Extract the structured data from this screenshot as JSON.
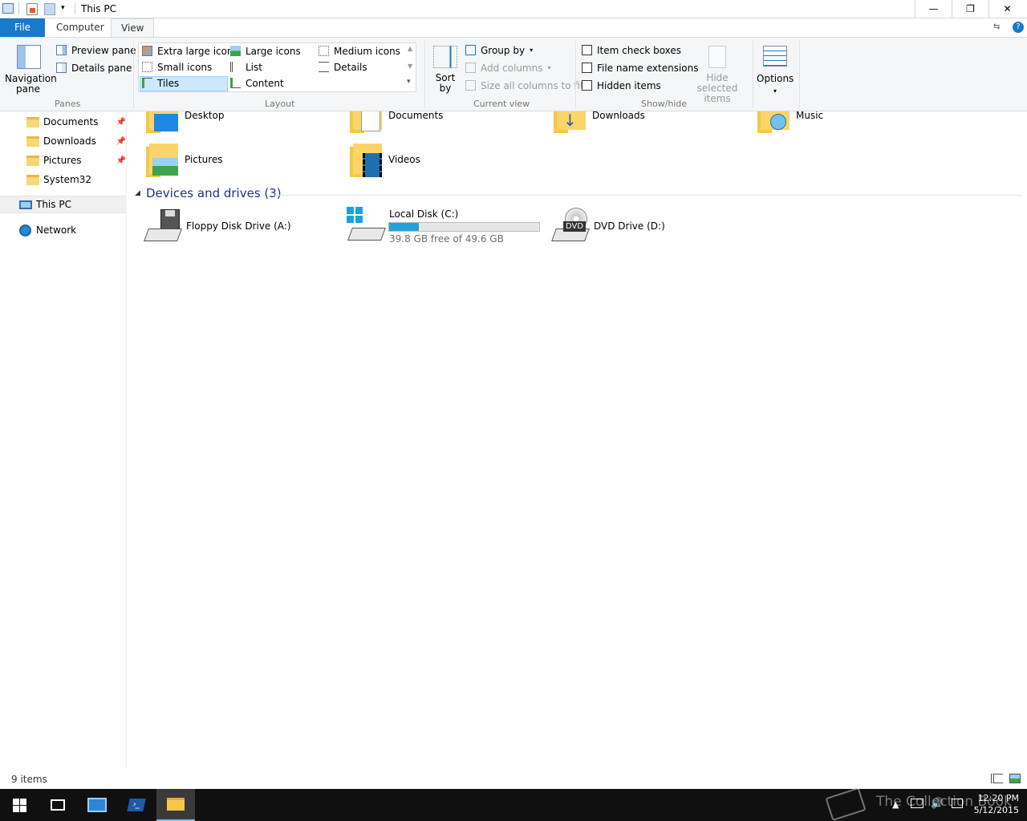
{
  "window": {
    "title": "This PC",
    "minimize_glyph": "—",
    "restore_glyph": "❐",
    "close_glyph": "✕"
  },
  "tabs": [
    {
      "label": "File"
    },
    {
      "label": "Computer"
    },
    {
      "label": "View"
    }
  ],
  "ribbon": {
    "panes": {
      "navigation_pane": "Navigation pane",
      "preview_pane": "Preview pane",
      "details_pane": "Details pane",
      "group_label": "Panes"
    },
    "layout": {
      "items": [
        "Extra large icons",
        "Large icons",
        "Medium icons",
        "Small icons",
        "List",
        "Details",
        "Tiles",
        "Content"
      ],
      "selected": "Tiles",
      "group_label": "Layout"
    },
    "current_view": {
      "sort_by": "Sort by",
      "group_by": "Group by",
      "add_columns": "Add columns",
      "size_all_columns": "Size all columns to fit",
      "group_label": "Current view"
    },
    "show_hide": {
      "item_check_boxes": "Item check boxes",
      "file_name_extensions": "File name extensions",
      "hidden_items": "Hidden items",
      "hide_selected_items": "Hide selected items",
      "group_label": "Show/hide"
    },
    "options": "Options"
  },
  "nav": {
    "items": [
      {
        "label": "Documents",
        "pinned": true
      },
      {
        "label": "Downloads",
        "pinned": true
      },
      {
        "label": "Pictures",
        "pinned": true
      },
      {
        "label": "System32",
        "pinned": false
      }
    ],
    "this_pc": "This PC",
    "network": "Network"
  },
  "folders": [
    {
      "label": "Desktop"
    },
    {
      "label": "Documents"
    },
    {
      "label": "Downloads"
    },
    {
      "label": "Music"
    },
    {
      "label": "Pictures"
    },
    {
      "label": "Videos"
    }
  ],
  "devices": {
    "header": "Devices and drives (3)",
    "items": [
      {
        "label": "Floppy Disk Drive (A:)"
      },
      {
        "label": "Local Disk (C:)",
        "free_text": "39.8 GB free of 49.6 GB",
        "used_fraction": 0.2
      },
      {
        "label": "DVD Drive (D:)",
        "badge": "DVD"
      }
    ]
  },
  "status": {
    "items_count": "9 items"
  },
  "taskbar": {
    "time": "12:20 PM",
    "date": "5/12/2015",
    "watermark": "The Collection Book"
  },
  "colors": {
    "accent": "#1979ca",
    "selection": "#cce8ff",
    "drive_fill": "#26a0da",
    "taskbar": "#101010"
  }
}
